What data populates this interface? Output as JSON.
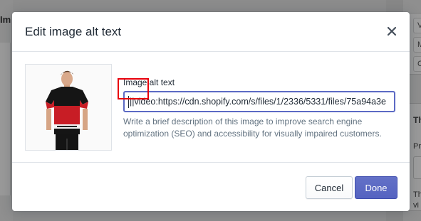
{
  "background": {
    "left_label": "Im",
    "right_chips": [
      "V",
      "M",
      "C"
    ],
    "right_heading": "Th",
    "right_label": "Pr",
    "right_text_lines": [
      "Th",
      "vi"
    ]
  },
  "modal": {
    "title": "Edit image alt text",
    "close_icon": "close-icon",
    "field_label": "Image alt text",
    "field_value": "||video:https://cdn.shopify.com/s/files/1/2336/5331/files/75a94a3e",
    "help_text": "Write a brief description of this image to improve search engine optimization (SEO) and accessibility for visually impaired customers.",
    "cancel_label": "Cancel",
    "done_label": "Done"
  },
  "colors": {
    "primary": "#5c6ac4",
    "highlight": "#e8000b",
    "text": "#212b36",
    "subdued": "#637381"
  }
}
